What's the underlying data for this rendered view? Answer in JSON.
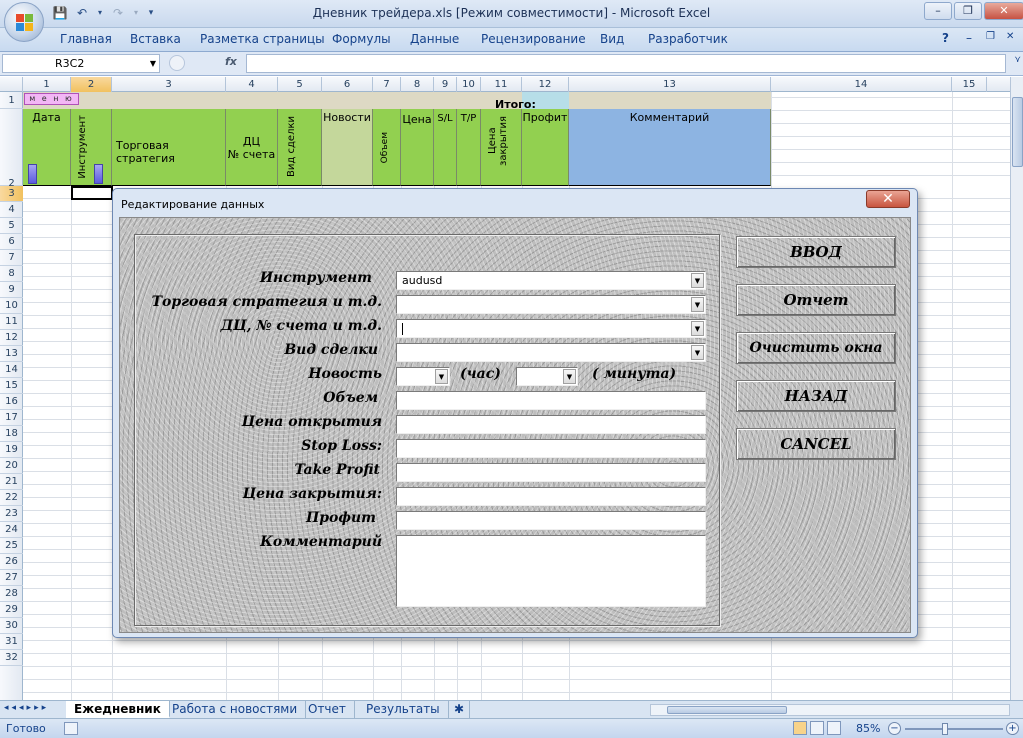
{
  "window": {
    "title": "Дневник трейдера.xls  [Режим совместимости] - Microsoft Excel",
    "minimize": "–",
    "restore": "❐",
    "close": "✕"
  },
  "ribbon": {
    "tabs": [
      "Главная",
      "Вставка",
      "Разметка страницы",
      "Формулы",
      "Данные",
      "Рецензирование",
      "Вид",
      "Разработчик"
    ],
    "help": "?",
    "min": "–",
    "restore": "❐",
    "close": "✕"
  },
  "formula_bar": {
    "name_box": "R3C2",
    "fx": "fx",
    "value": ""
  },
  "columns": [
    "1",
    "2",
    "3",
    "4",
    "5",
    "6",
    "7",
    "8",
    "9",
    "10",
    "11",
    "12",
    "13",
    "14",
    "15"
  ],
  "rows": [
    "1",
    "2",
    "3",
    "4",
    "5",
    "6",
    "7",
    "8",
    "9",
    "10",
    "11",
    "12",
    "13",
    "14",
    "15",
    "16",
    "17",
    "18",
    "19",
    "20",
    "21",
    "22",
    "23",
    "24",
    "25",
    "26",
    "27",
    "28",
    "29",
    "30",
    "31",
    "32"
  ],
  "sheet": {
    "menu_button": "м е н ю",
    "itogo": "Итого:",
    "headers": {
      "date": "Дата",
      "instrument": "Инструмент",
      "strategy": "Торговая стратегия",
      "dc_line1": "ДЦ",
      "dc_line2": "№ счета",
      "deal_type": "Вид сделки",
      "news": "Новости",
      "volume": "Объем",
      "price": "Цена",
      "sl": "S/L",
      "tp": "T/P",
      "close_price": "Цена закрытия",
      "profit": "Профит",
      "comment": "Комментарий"
    }
  },
  "dialog": {
    "title": "Редактирование данных",
    "close": "✕",
    "labels": {
      "instrument": "Инструмент",
      "strategy": "Торговая стратегия и т.д.",
      "dc": "ДЦ, № счета и т.д.",
      "deal_type": "Вид сделки",
      "news": "Новость",
      "hour": "(час)",
      "minute": "( минута)",
      "volume": "Объем",
      "open_price": "Цена открытия",
      "stop_loss": "Stop Loss:",
      "take_profit": "Take Profit",
      "close_price": "Цена закрытия:",
      "profit": "Профит",
      "comment": "Комментарий"
    },
    "values": {
      "instrument": "audusd",
      "strategy": "",
      "dc": "",
      "deal_type": "",
      "hour": "",
      "minute": "",
      "volume": "",
      "open_price": "",
      "stop_loss": "",
      "take_profit": "",
      "close_price": "",
      "profit": "",
      "comment": ""
    },
    "buttons": {
      "enter": "ВВОД",
      "report": "Отчет",
      "clear": "Очистить окна",
      "back": "НАЗАД",
      "cancel": "CANCEL"
    }
  },
  "sheet_tabs": [
    "Ежедневник",
    "Работа с новостями",
    "Отчет",
    "Результаты"
  ],
  "status": {
    "ready": "Готово",
    "zoom": "85%",
    "zoom_out": "−",
    "zoom_in": "+"
  },
  "colors": {
    "header_green": "#92d050",
    "header_olive": "#c4d79b",
    "header_blue": "#8db4e2",
    "selection_orange": "#f1c15f"
  }
}
